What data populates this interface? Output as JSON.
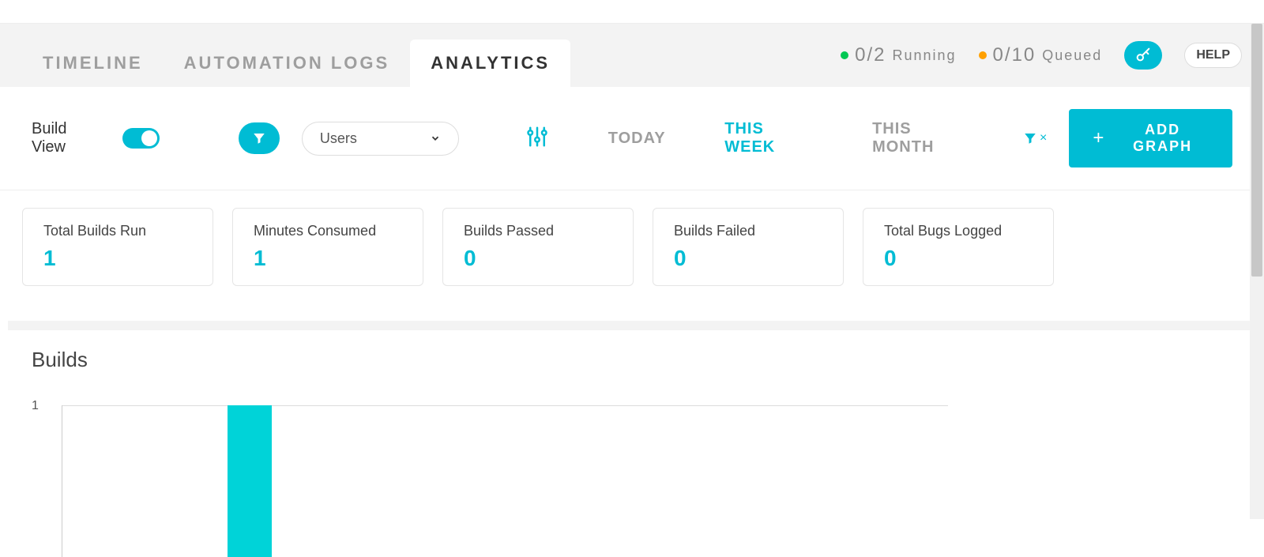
{
  "tabs": {
    "timeline": "TIMELINE",
    "automation_logs": "AUTOMATION LOGS",
    "analytics": "ANALYTICS"
  },
  "status": {
    "running_count": "0/2",
    "running_label": "Running",
    "queued_count": "0/10",
    "queued_label": "Queued"
  },
  "help_label": "HELP",
  "controls": {
    "build_view_label": "Build View",
    "select_value": "Users",
    "time_tabs": {
      "today": "TODAY",
      "this_week": "THIS WEEK",
      "this_month": "THIS MONTH"
    },
    "clear_x": "×",
    "add_graph_label": "ADD GRAPH"
  },
  "cards": [
    {
      "title": "Total Builds Run",
      "value": "1"
    },
    {
      "title": "Minutes Consumed",
      "value": "1"
    },
    {
      "title": "Builds Passed",
      "value": "0"
    },
    {
      "title": "Builds Failed",
      "value": "0"
    },
    {
      "title": "Total Bugs Logged",
      "value": "0"
    }
  ],
  "chart": {
    "title": "Builds",
    "y_tick": "1"
  },
  "chart_data": {
    "type": "bar",
    "title": "Builds",
    "categories": [
      "",
      "",
      "",
      "",
      "",
      "",
      ""
    ],
    "values": [
      0,
      1,
      0,
      0,
      0,
      0,
      0
    ],
    "ylabel": "",
    "xlabel": "",
    "ylim": [
      0,
      1
    ]
  },
  "colors": {
    "accent": "#00bcd4",
    "bar": "#00d3d8"
  }
}
